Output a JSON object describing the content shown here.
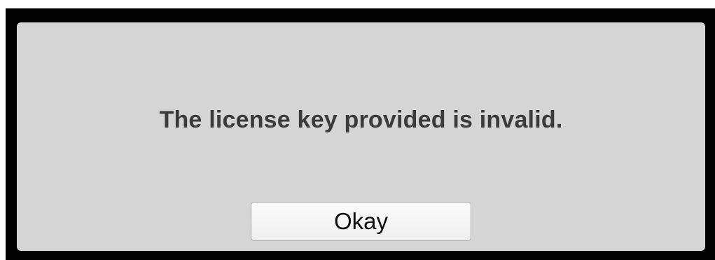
{
  "dialog": {
    "message": "The license key provided is invalid.",
    "okay_label": "Okay"
  },
  "colors": {
    "frame": "#020202",
    "panel": "#d5d5d5",
    "message_text": "#3b3b3b",
    "button_background": "#f5f5f5",
    "button_border": "#a6a6a6"
  }
}
